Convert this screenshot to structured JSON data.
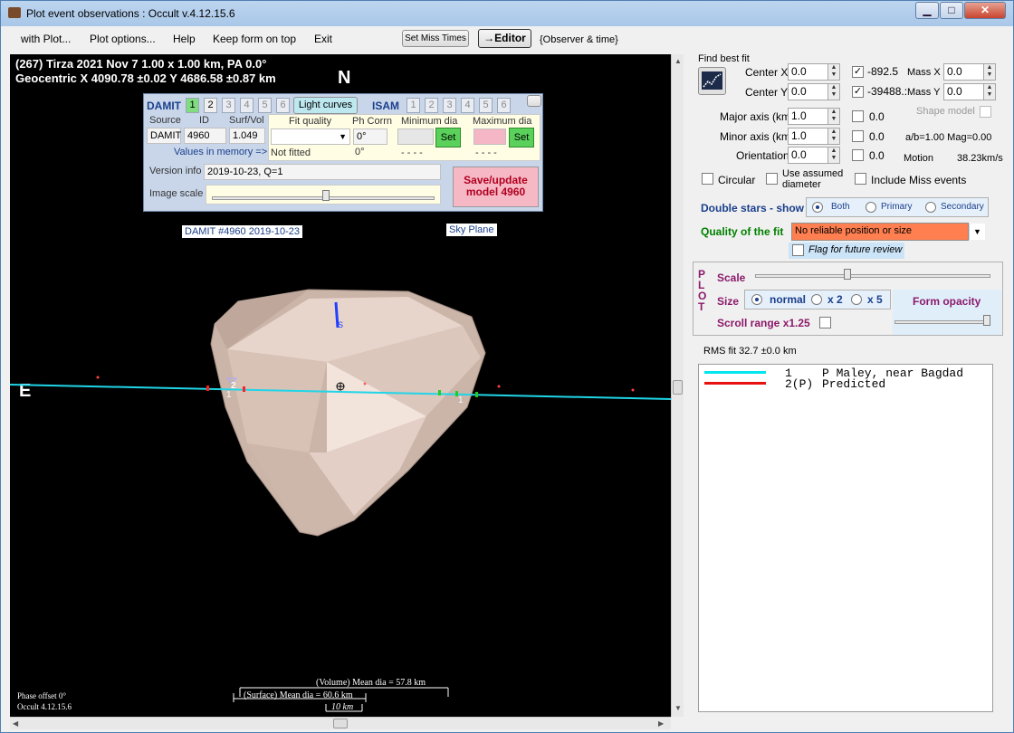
{
  "window": {
    "title": "Plot event observations : Occult v.4.12.15.6",
    "minimize": "▁",
    "maximize": "□",
    "close": "✕"
  },
  "menu": {
    "items": [
      "with Plot...",
      "Plot options...",
      "Help",
      "Keep form on top",
      "Exit"
    ],
    "set_miss_times": "Set Miss Times",
    "editor": "→Editor",
    "observer_time": "{Observer & time}"
  },
  "plot": {
    "header_line1": "(267) Tirza  2021 Nov 7   1.00 x 1.00 km, PA 0.0°",
    "header_line2": "Geocentric  X 4090.78 ±0.02  Y 4686.58 ±0.87 km",
    "north_label": "N",
    "east_label": "E",
    "damit_label": "DAMIT #4960 2019-10-23",
    "sky_plane_label": "Sky Plane",
    "south_label": "S",
    "chord_label_1": "1",
    "chord_label_2": "2",
    "chord_label_1b": "1",
    "volume_dia": "(Volume) Mean dia = 57.8 km",
    "surface_dia": "(Surface) Mean dia = 60.6 km",
    "scale_bar": "10 km",
    "phase_offset": "Phase offset 0°",
    "version": "Occult 4.12.15.6"
  },
  "damit_panel": {
    "damit_title": "DAMIT",
    "damit_numbers": [
      "1",
      "2",
      "3",
      "4",
      "5",
      "6"
    ],
    "light_curves": "Light curves",
    "isam_title": "ISAM",
    "isam_numbers": [
      "1",
      "2",
      "3",
      "4",
      "5",
      "6"
    ],
    "source_lbl": "Source",
    "id_lbl": "ID",
    "surfvol_lbl": "Surf/Vol",
    "source_val": "DAMIT",
    "id_val": "4960",
    "surfvol_val": "1.049",
    "values_in_memory": "Values in memory =>",
    "fit_quality_lbl": "Fit quality",
    "ph_corr_lbl": "Ph Corrn",
    "min_dia_lbl": "Minimum dia",
    "max_dia_lbl": "Maximum dia",
    "ph_corr_val": "0°",
    "set_label": "Set",
    "not_fitted": "Not fitted",
    "ph_corr_mem": "0°",
    "min_dia_mem": "- - - -",
    "max_dia_mem": "- - - -",
    "version_info_lbl": "Version info",
    "version_info_val": "2019-10-23, Q=1",
    "image_scale_lbl": "Image scale",
    "save_update": "Save/update model 4960"
  },
  "fit_panel": {
    "find_best_fit": "Find best fit",
    "center_x_lbl": "Center X",
    "center_x_val": "0.0",
    "center_y_lbl": "Center Y",
    "center_y_val": "0.0",
    "cx_result": "-892.5",
    "cy_result": "-39488.:",
    "mass_x_lbl": "Mass X",
    "mass_x_val": "0.0",
    "mass_y_lbl": "Mass Y",
    "mass_y_val": "0.0",
    "major_lbl": "Major axis (km)",
    "major_val": "1.0",
    "major_result": "0.0",
    "minor_lbl": "Minor axis (km)",
    "minor_val": "1.0",
    "minor_result": "0.0",
    "orient_lbl": "Orientation",
    "orient_val": "0.0",
    "orient_result": "0.0",
    "shape_model": "Shape model",
    "ab_mag": "a/b=1.00 Mag=0.00",
    "motion_lbl": "Motion",
    "motion_val": "38.23km/s",
    "circular": "Circular",
    "use_assumed": "Use assumed diameter",
    "include_miss": "Include Miss events",
    "double_stars": "Double stars - show",
    "both": "Both",
    "primary": "Primary",
    "secondary": "Secondary",
    "quality_lbl": "Quality of the fit",
    "quality_val": "No reliable position or size",
    "flag_review": "Flag for future review"
  },
  "plot_panel": {
    "plot_vertical": [
      "P",
      "L",
      "O",
      "T"
    ],
    "scale_lbl": "Scale",
    "size_lbl": "Size",
    "normal": "normal",
    "x2": "x 2",
    "x5": "x 5",
    "form_opacity": "Form opacity",
    "scroll_range": "Scroll range x1.25",
    "rms_fit": "RMS fit 32.7 ±0.0 km"
  },
  "legend": {
    "rows": [
      {
        "num": "1",
        "name": "P Maley, near Bagdad",
        "color": "#00e5ee"
      },
      {
        "num": "2(P)",
        "name": "Predicted",
        "color": "#e81010"
      }
    ]
  }
}
